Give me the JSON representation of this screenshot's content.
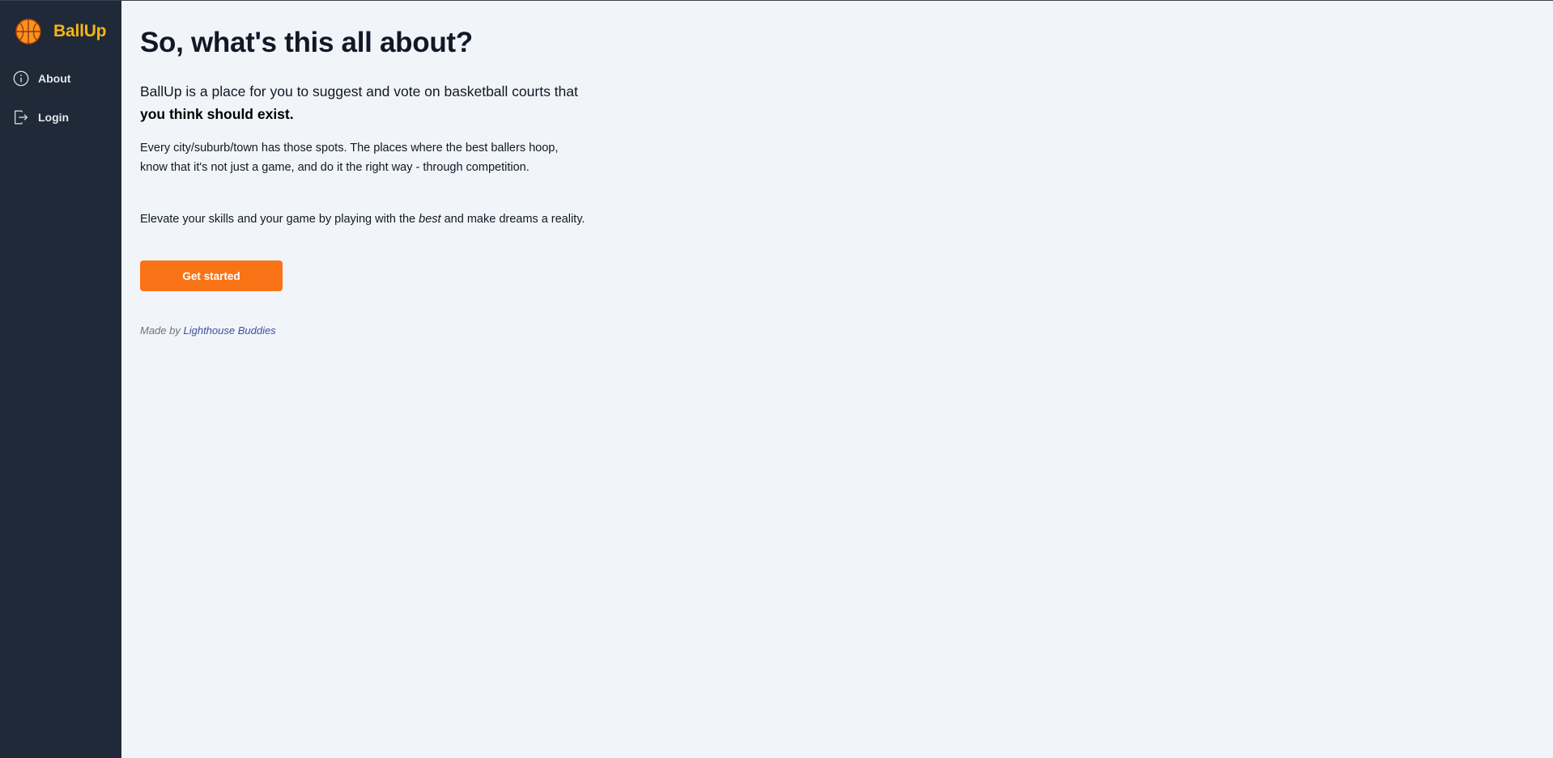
{
  "app": {
    "name": "BallUp"
  },
  "sidebar": {
    "logo_icon": "basketball-icon",
    "items": [
      {
        "label": "About",
        "icon": "info-circle-icon"
      },
      {
        "label": "Login",
        "icon": "login-door-icon"
      }
    ]
  },
  "main": {
    "heading": "So, what's this all about?",
    "lead_text": "BallUp is a place for you to suggest and vote on basketball courts that ",
    "lead_bold": "you think should exist.",
    "paragraph1": "Every city/suburb/town has those spots. The places where the best ballers hoop, know that it's not just a game, and do it the right way - through competition.",
    "paragraph2_before": "Elevate your skills and your game by playing with the ",
    "paragraph2_emphasis": "best",
    "paragraph2_after": " and make dreams a reality.",
    "cta_label": "Get started",
    "footer_prefix": "Made by ",
    "footer_link": "Lighthouse Buddies"
  },
  "colors": {
    "sidebar_bg": "#1f2937",
    "page_bg": "#f1f5f9",
    "brand": "#f5b418",
    "accent": "#f97316",
    "link": "#3f4fa0"
  }
}
